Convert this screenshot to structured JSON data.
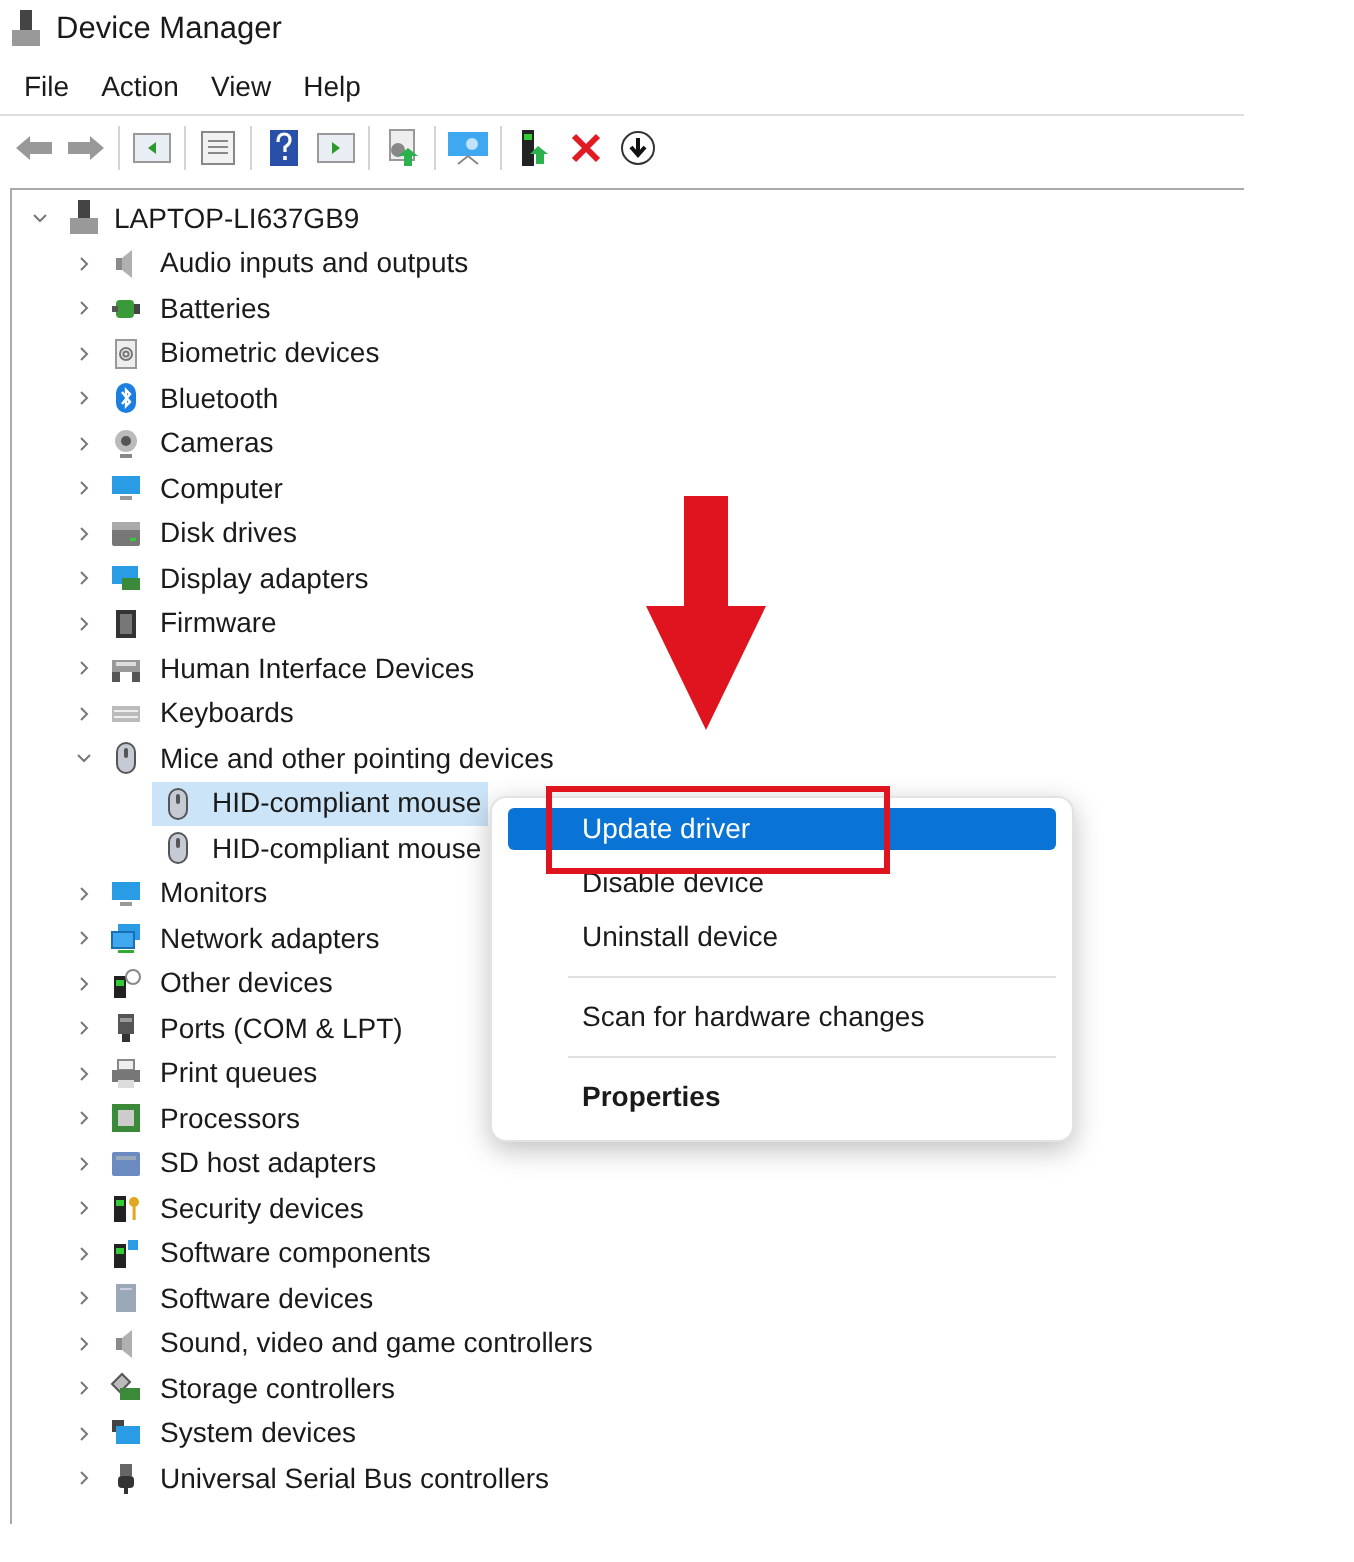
{
  "window": {
    "title": "Device Manager"
  },
  "menu": [
    "File",
    "Action",
    "View",
    "Help"
  ],
  "tree": {
    "label": "LAPTOP-LI637GB9",
    "expanded": true,
    "children": [
      {
        "label": "Audio inputs and outputs",
        "expanded": false
      },
      {
        "label": "Batteries",
        "expanded": false
      },
      {
        "label": "Biometric devices",
        "expanded": false
      },
      {
        "label": "Bluetooth",
        "expanded": false
      },
      {
        "label": "Cameras",
        "expanded": false
      },
      {
        "label": "Computer",
        "expanded": false
      },
      {
        "label": "Disk drives",
        "expanded": false
      },
      {
        "label": "Display adapters",
        "expanded": false
      },
      {
        "label": "Firmware",
        "expanded": false
      },
      {
        "label": "Human Interface Devices",
        "expanded": false
      },
      {
        "label": "Keyboards",
        "expanded": false
      },
      {
        "label": "Mice and other pointing devices",
        "expanded": true,
        "children": [
          {
            "label": "HID-compliant mouse",
            "selected": true
          },
          {
            "label": "HID-compliant mouse",
            "selected": false
          }
        ]
      },
      {
        "label": "Monitors",
        "expanded": false
      },
      {
        "label": "Network adapters",
        "expanded": false
      },
      {
        "label": "Other devices",
        "expanded": false
      },
      {
        "label": "Ports (COM & LPT)",
        "expanded": false
      },
      {
        "label": "Print queues",
        "expanded": false
      },
      {
        "label": "Processors",
        "expanded": false
      },
      {
        "label": "SD host adapters",
        "expanded": false
      },
      {
        "label": "Security devices",
        "expanded": false
      },
      {
        "label": "Software components",
        "expanded": false
      },
      {
        "label": "Software devices",
        "expanded": false
      },
      {
        "label": "Sound, video and game controllers",
        "expanded": false
      },
      {
        "label": "Storage controllers",
        "expanded": false
      },
      {
        "label": "System devices",
        "expanded": false
      },
      {
        "label": "Universal Serial Bus controllers",
        "expanded": false
      }
    ]
  },
  "context_menu": {
    "items": [
      {
        "kind": "item",
        "label": "Update driver",
        "selected": true
      },
      {
        "kind": "item",
        "label": "Disable device",
        "selected": false
      },
      {
        "kind": "item",
        "label": "Uninstall device",
        "selected": false
      },
      {
        "kind": "separator"
      },
      {
        "kind": "item",
        "label": "Scan for hardware changes",
        "selected": false
      },
      {
        "kind": "separator"
      },
      {
        "kind": "default",
        "label": "Properties",
        "selected": false
      }
    ]
  }
}
